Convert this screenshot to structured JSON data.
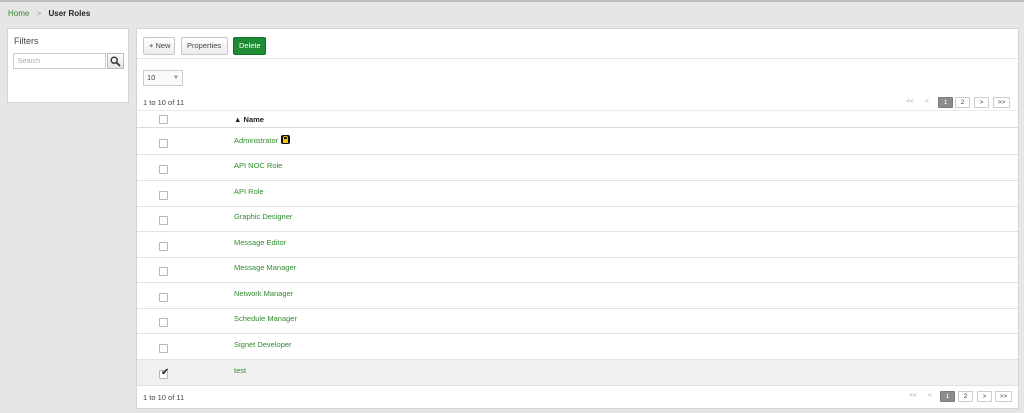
{
  "breadcrumb": {
    "home": "Home",
    "separator": ">",
    "current": "User Roles"
  },
  "filters": {
    "title": "Filters",
    "search_placeholder": "Search",
    "search_icon": "magnifier-icon"
  },
  "toolbar": {
    "new_label": "+ New",
    "properties_label": "Properties",
    "delete_label": "Delete",
    "delete_color": "#1e8a34"
  },
  "page_size": {
    "selected": "10"
  },
  "results": {
    "count_top": "1 to 10 of 11",
    "count_bottom": "1 to 10 of 11"
  },
  "pagination": {
    "first": "<<",
    "prev": "<",
    "pages": [
      "1",
      "2"
    ],
    "current_page": "1",
    "next": ">",
    "last": ">>"
  },
  "table": {
    "sort_indicator": "▲",
    "column_name": "Name",
    "rows": [
      {
        "name": "Administrator",
        "locked": true,
        "checked": false
      },
      {
        "name": "API NOC Role",
        "locked": false,
        "checked": false
      },
      {
        "name": "API Role",
        "locked": false,
        "checked": false
      },
      {
        "name": "Graphic Designer",
        "locked": false,
        "checked": false
      },
      {
        "name": "Message Editor",
        "locked": false,
        "checked": false
      },
      {
        "name": "Message Manager",
        "locked": false,
        "checked": false
      },
      {
        "name": "Network Manager",
        "locked": false,
        "checked": false
      },
      {
        "name": "Schedule Manager",
        "locked": false,
        "checked": false
      },
      {
        "name": "Signet Developer",
        "locked": false,
        "checked": false
      },
      {
        "name": "test",
        "locked": false,
        "checked": true
      }
    ]
  },
  "colors": {
    "link": "#2e8b2e",
    "background": "#e6e6e6",
    "active_page": "#8c8c8c"
  }
}
